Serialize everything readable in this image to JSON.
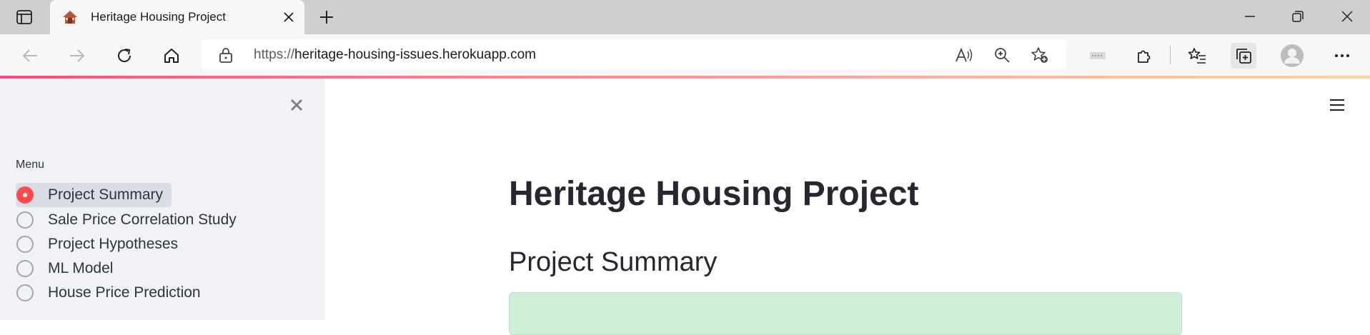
{
  "browser": {
    "tab_title": "Heritage Housing Project",
    "url_protocol": "https://",
    "url_host": "heritage-housing-issues.herokuapp.com"
  },
  "sidebar": {
    "menu_label": "Menu",
    "items": [
      {
        "label": "Project Summary",
        "selected": true
      },
      {
        "label": "Sale Price Correlation Study",
        "selected": false
      },
      {
        "label": "Project Hypotheses",
        "selected": false
      },
      {
        "label": "ML Model",
        "selected": false
      },
      {
        "label": "House Price Prediction",
        "selected": false
      }
    ]
  },
  "main": {
    "title": "Heritage Housing Project",
    "section_title": "Project Summary"
  },
  "colors": {
    "accent": "#ff4b4b",
    "sidebar_bg": "#f0f2f6",
    "alert_bg": "#cfeed7"
  }
}
